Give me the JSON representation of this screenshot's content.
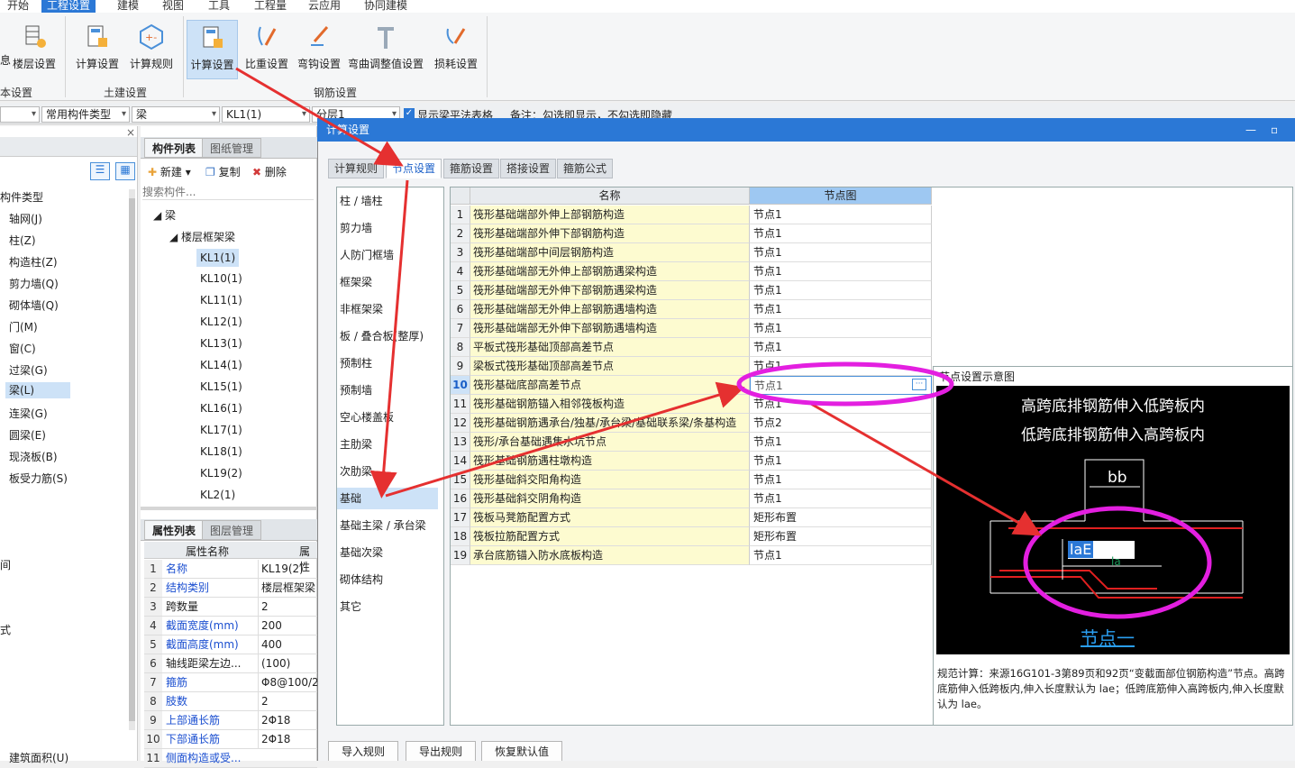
{
  "menu": [
    "开始",
    "工程设置",
    "建模",
    "视图",
    "工具",
    "工程量",
    "云应用",
    "协同建模"
  ],
  "ribbon": {
    "buttons": [
      "楼层设置",
      "计算设置",
      "计算规则",
      "计算设置",
      "比重设置",
      "弯钩设置",
      "弯曲调整值设置",
      "损耗设置"
    ],
    "partial_left": "息",
    "groups": [
      "本设置",
      "土建设置",
      "钢筋设置"
    ]
  },
  "toolbar2": {
    "combo1": "常用构件类型",
    "combo2": "梁",
    "combo3": "KL1(1)",
    "combo4": "分层1",
    "checkbox_label": "显示梁平法表格",
    "note": "备注：勾选即显示，不勾选即隐藏"
  },
  "left_panel": {
    "header": "构件类型",
    "items": [
      "轴网(J)",
      "柱(Z)",
      "构造柱(Z)",
      "剪力墙(Q)",
      "砌体墙(Q)",
      "门(M)",
      "窗(C)",
      "过梁(G)",
      "梁(L)",
      "连梁(G)",
      "圆梁(E)",
      "现浇板(B)",
      "板受力筋(S)"
    ],
    "partial": [
      "间",
      "式"
    ],
    "bottom": "建筑面积(U)"
  },
  "mid_panel": {
    "tabs": [
      "构件列表",
      "图纸管理"
    ],
    "new": "新建",
    "copy": "复制",
    "delete": "删除",
    "search_placeholder": "搜索构件...",
    "tree_root": "梁",
    "tree_child": "楼层框架梁",
    "members": [
      "KL1(1)",
      "KL10(1)",
      "KL11(1)",
      "KL12(1)",
      "KL13(1)",
      "KL14(1)",
      "KL15(1)",
      "KL16(1)",
      "KL17(1)",
      "KL18(1)",
      "KL19(2)",
      "KL2(1)"
    ],
    "prop_tabs": [
      "属性列表",
      "图层管理"
    ],
    "prop_head": [
      "属性名称",
      "属性"
    ],
    "props": [
      {
        "n": "1",
        "k": "名称",
        "v": "KL19(2)",
        "blue": true
      },
      {
        "n": "2",
        "k": "结构类别",
        "v": "楼层框架梁",
        "blue": true
      },
      {
        "n": "3",
        "k": "跨数量",
        "v": "2",
        "blue": false
      },
      {
        "n": "4",
        "k": "截面宽度(mm)",
        "v": "200",
        "blue": true
      },
      {
        "n": "5",
        "k": "截面高度(mm)",
        "v": "400",
        "blue": true
      },
      {
        "n": "6",
        "k": "轴线距梁左边...",
        "v": "(100)",
        "blue": false
      },
      {
        "n": "7",
        "k": "箍筋",
        "v": "Φ8@100/2(",
        "blue": true
      },
      {
        "n": "8",
        "k": "肢数",
        "v": "2",
        "blue": true
      },
      {
        "n": "9",
        "k": "上部通长筋",
        "v": "2Φ18",
        "blue": true
      },
      {
        "n": "10",
        "k": "下部通长筋",
        "v": "2Φ18",
        "blue": true
      },
      {
        "n": "11",
        "k": "侧面构造或受...",
        "v": "",
        "blue": true
      }
    ]
  },
  "dialog": {
    "title": "计算设置",
    "tabs": [
      "计算规则",
      "节点设置",
      "箍筋设置",
      "搭接设置",
      "箍筋公式"
    ],
    "categories": [
      "柱 / 墙柱",
      "剪力墙",
      "人防门框墙",
      "框架梁",
      "非框架梁",
      "板 / 叠合板(整厚)",
      "预制柱",
      "预制墙",
      "空心楼盖板",
      "主肋梁",
      "次肋梁",
      "基础",
      "基础主梁 / 承台梁",
      "基础次梁",
      "砌体结构",
      "其它"
    ],
    "grid_head": [
      "名称",
      "节点图"
    ],
    "rows": [
      {
        "no": "1",
        "name": "筏形基础端部外伸上部钢筋构造",
        "node": "节点1"
      },
      {
        "no": "2",
        "name": "筏形基础端部外伸下部钢筋构造",
        "node": "节点1"
      },
      {
        "no": "3",
        "name": "筏形基础端部中间层钢筋构造",
        "node": "节点1"
      },
      {
        "no": "4",
        "name": "筏形基础端部无外伸上部钢筋遇梁构造",
        "node": "节点1"
      },
      {
        "no": "5",
        "name": "筏形基础端部无外伸下部钢筋遇梁构造",
        "node": "节点1"
      },
      {
        "no": "6",
        "name": "筏形基础端部无外伸上部钢筋遇墙构造",
        "node": "节点1"
      },
      {
        "no": "7",
        "name": "筏形基础端部无外伸下部钢筋遇墙构造",
        "node": "节点1"
      },
      {
        "no": "8",
        "name": "平板式筏形基础顶部高差节点",
        "node": "节点1"
      },
      {
        "no": "9",
        "name": "梁板式筏形基础顶部高差节点",
        "node": "节点1"
      },
      {
        "no": "10",
        "name": "筏形基础底部高差节点",
        "node": "节点1"
      },
      {
        "no": "11",
        "name": "筏形基础钢筋锚入相邻筏板构造",
        "node": "节点1"
      },
      {
        "no": "12",
        "name": "筏形基础钢筋遇承台/独基/承台梁/基础联系梁/条基构造",
        "node": "节点2"
      },
      {
        "no": "13",
        "name": "筏形/承台基础遇集水坑节点",
        "node": "节点1"
      },
      {
        "no": "14",
        "name": "筏形基础钢筋遇柱墩构造",
        "node": "节点1"
      },
      {
        "no": "15",
        "name": "筏形基础斜交阳角构造",
        "node": "节点1"
      },
      {
        "no": "16",
        "name": "筏形基础斜交阴角构造",
        "node": "节点1"
      },
      {
        "no": "17",
        "name": "筏板马凳筋配置方式",
        "node": "矩形布置"
      },
      {
        "no": "18",
        "name": "筏板拉筋配置方式",
        "node": "矩形布置"
      },
      {
        "no": "19",
        "name": "承台底筋锚入防水底板构造",
        "node": "节点1"
      }
    ],
    "preview_title": "节点设置示意图",
    "preview_line1": "高跨底排钢筋伸入低跨板内",
    "preview_line2": "低跨底排钢筋伸入高跨板内",
    "preview_bb": "bb",
    "preview_lae": "laE",
    "preview_la": "la",
    "preview_caption": "节点一",
    "preview_desc": "规范计算：来源16G101-3第89页和92页“变截面部位钢筋构造”节点。高跨底筋伸入低跨板内,伸入长度默认为 lae；低跨底筋伸入高跨板内,伸入长度默认为 lae。",
    "buttons": [
      "导入规则",
      "导出规则",
      "恢复默认值"
    ]
  }
}
